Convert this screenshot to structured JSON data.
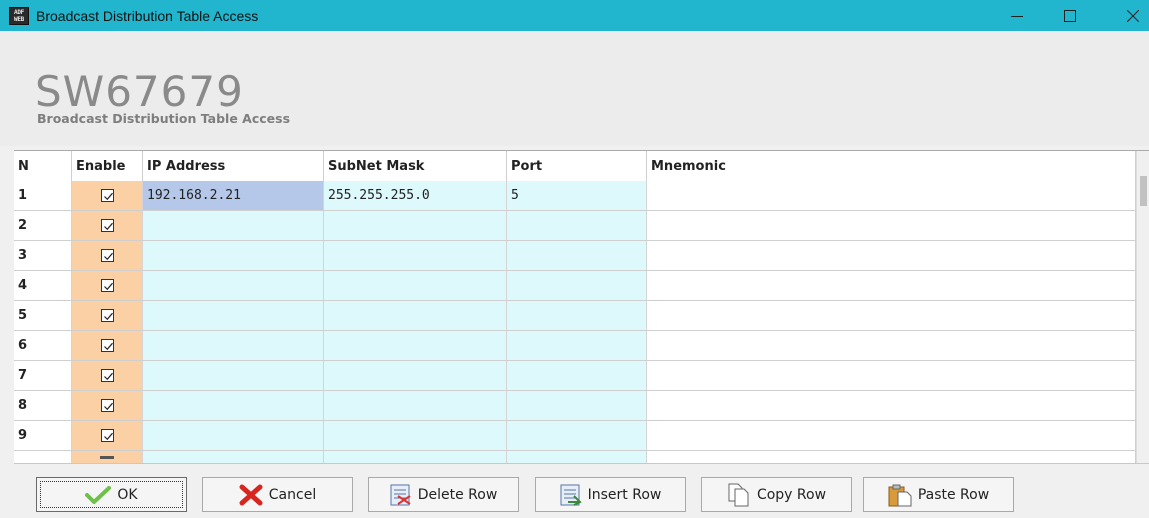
{
  "window": {
    "title": "Broadcast Distribution Table Access",
    "app_icon_top": "ADF",
    "app_icon_bottom": "WEB"
  },
  "header": {
    "product_code": "SW67679",
    "subtitle": "Broadcast Distribution Table Access"
  },
  "table": {
    "columns": [
      "N",
      "Enable",
      "IP Address",
      "SubNet Mask",
      "Port",
      "Mnemonic"
    ],
    "rows": [
      {
        "n": "1",
        "enabled": true,
        "ip": "192.168.2.21",
        "mask": "255.255.255.0",
        "port": "5",
        "mnemonic": ""
      },
      {
        "n": "2",
        "enabled": true,
        "ip": "",
        "mask": "",
        "port": "",
        "mnemonic": ""
      },
      {
        "n": "3",
        "enabled": true,
        "ip": "",
        "mask": "",
        "port": "",
        "mnemonic": ""
      },
      {
        "n": "4",
        "enabled": true,
        "ip": "",
        "mask": "",
        "port": "",
        "mnemonic": ""
      },
      {
        "n": "5",
        "enabled": true,
        "ip": "",
        "mask": "",
        "port": "",
        "mnemonic": ""
      },
      {
        "n": "6",
        "enabled": true,
        "ip": "",
        "mask": "",
        "port": "",
        "mnemonic": ""
      },
      {
        "n": "7",
        "enabled": true,
        "ip": "",
        "mask": "",
        "port": "",
        "mnemonic": ""
      },
      {
        "n": "8",
        "enabled": true,
        "ip": "",
        "mask": "",
        "port": "",
        "mnemonic": ""
      },
      {
        "n": "9",
        "enabled": true,
        "ip": "",
        "mask": "",
        "port": "",
        "mnemonic": ""
      }
    ]
  },
  "buttons": {
    "ok": "OK",
    "cancel": "Cancel",
    "delete_row": "Delete Row",
    "insert_row": "Insert Row",
    "copy_row": "Copy Row",
    "paste_row": "Paste Row"
  },
  "colors": {
    "titlebar": "#21b6cd",
    "enable_column": "#fbd0a4",
    "editable_cell": "#ddf9fc",
    "selected_cell": "#b5c8ea"
  }
}
